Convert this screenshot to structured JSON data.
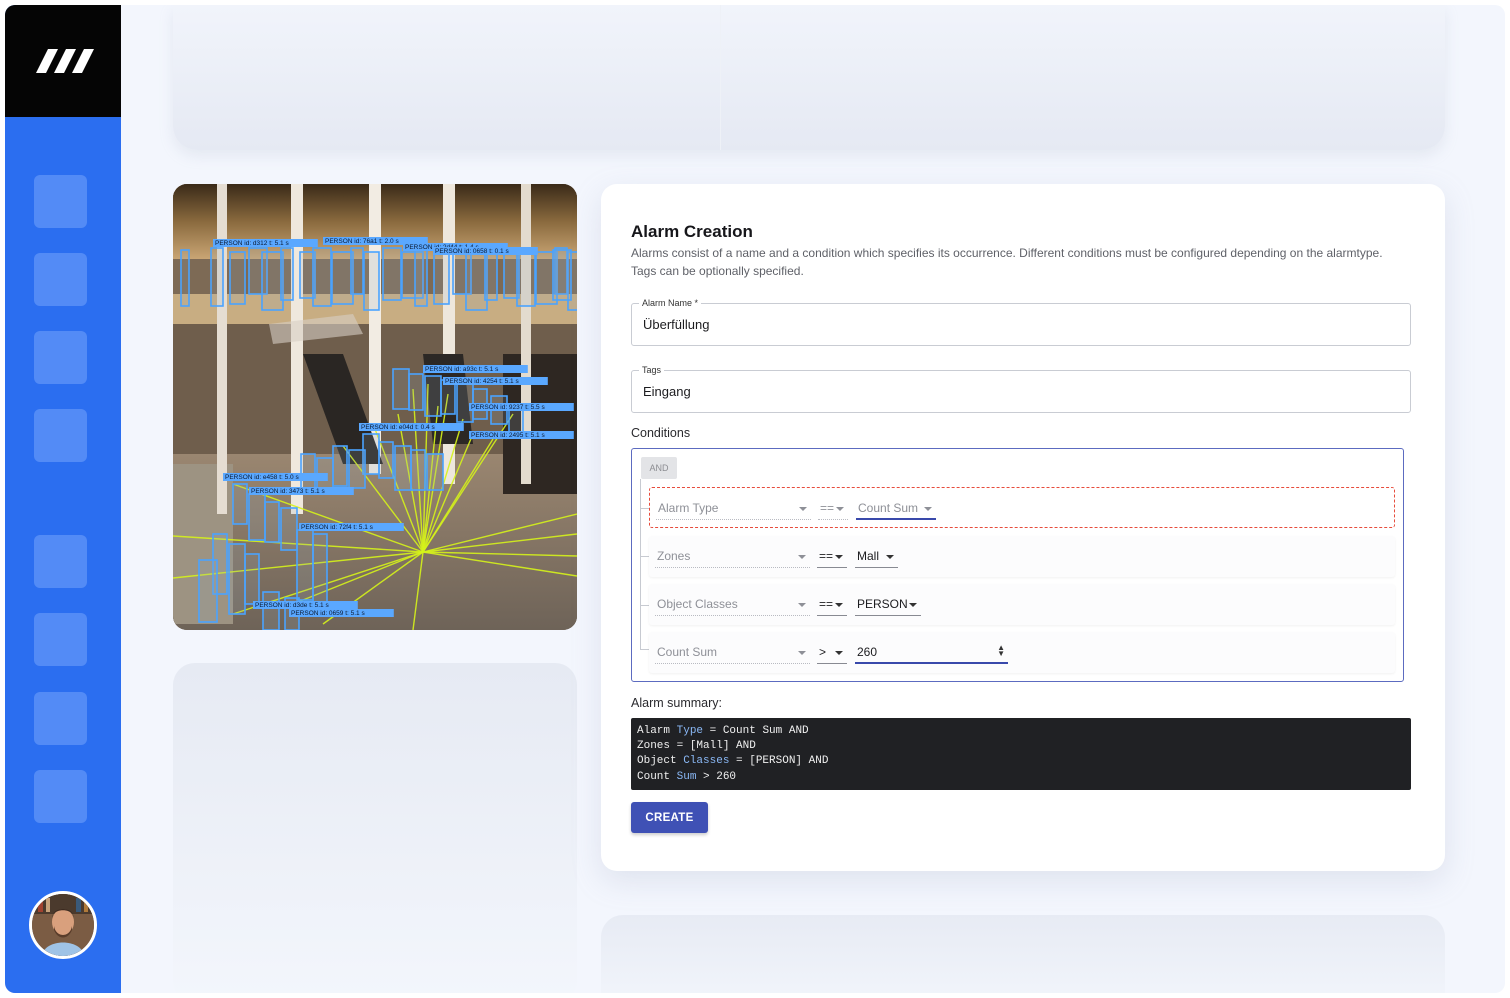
{
  "alarm_creation": {
    "title": "Alarm Creation",
    "description": "Alarms consist of a name and a condition which specifies its occurrence. Different conditions must be configured depending on the alarmtype. Tags can be optionally specified.",
    "alarm_name_label": "Alarm Name *",
    "alarm_name_value": "Überfüllung",
    "tags_label": "Tags",
    "tags_value": "Eingang",
    "conditions_label": "Conditions",
    "operator_chip": "AND",
    "conditions": [
      {
        "field": "Alarm Type",
        "operator": "==",
        "value": "Count Sum"
      },
      {
        "field": "Zones",
        "operator": "==",
        "value": "Mall"
      },
      {
        "field": "Object Classes",
        "operator": "==",
        "value": "PERSON"
      },
      {
        "field": "Count Sum",
        "operator": ">",
        "value": "260"
      }
    ],
    "summary_label": "Alarm summary:",
    "create_label": "CREATE"
  },
  "camera": {
    "detections": [
      "PERSON id: d312 t: 5.1 s",
      "PERSON id: 76a1 t: 2.0 s",
      "PERSON id: 2d44 t: 1.4 s",
      "PERSON id: 0658 t: 0.1 s",
      "PERSON id: a93c t: 5.1 s",
      "PERSON id: 4254 t: 5.1 s",
      "PERSON id: 9237 t: 5.5 s",
      "PERSON id: e04d t: 0.4 s",
      "PERSON id: 2495 t: 5.1 s",
      "PERSON id: e458 t: 5.0 s",
      "PERSON id: 3473 t: 5.1 s",
      "PERSON id: 72f4 t: 5.1 s",
      "PERSON id: d3de t: 5.1 s",
      "PERSON id: 0659 t: 5.1 s"
    ]
  },
  "colors": {
    "sidebar": "#2b6ef0",
    "accent": "#3f51b5",
    "error_outline": "#e74c3c",
    "detection_box": "#4aa3ff",
    "trajectory": "#d6f31a"
  }
}
